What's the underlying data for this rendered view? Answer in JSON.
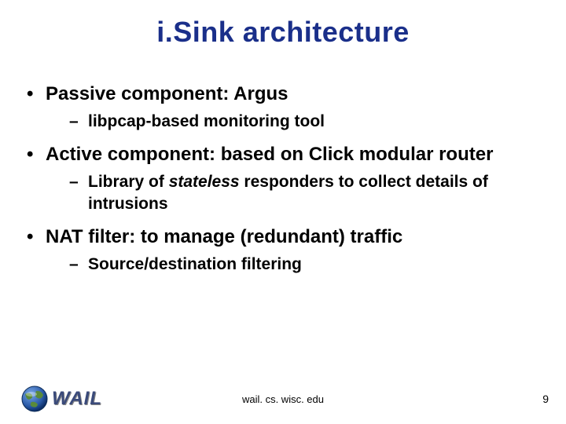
{
  "title": "i.Sink architecture",
  "bullets": [
    {
      "text": "Passive component:  Argus",
      "sub": [
        {
          "text": "libpcap-based monitoring tool"
        }
      ]
    },
    {
      "text": "Active component:  based on Click modular router",
      "sub": [
        {
          "prefix": "Library of ",
          "em": "stateless",
          "suffix": " responders to collect details of intrusions"
        }
      ]
    },
    {
      "text": "NAT filter: to manage (redundant) traffic",
      "sub": [
        {
          "text": "Source/destination filtering"
        }
      ]
    }
  ],
  "footer": {
    "domain": "wail. cs. wisc. edu",
    "page": "9",
    "logo_text": "WAIL"
  }
}
